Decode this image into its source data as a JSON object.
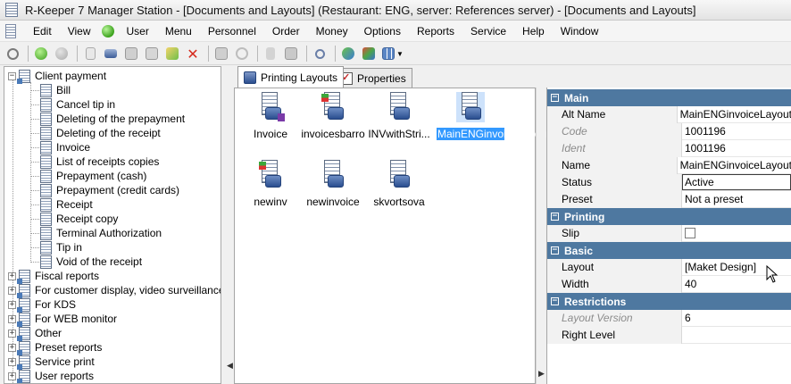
{
  "window": {
    "title": "R-Keeper 7 Manager Station - [Documents and Layouts] (Restaurant: ENG, server: References server) - [Documents and Layouts]"
  },
  "menu": [
    "Edit",
    "View",
    "User",
    "Menu",
    "Personnel",
    "Order",
    "Money",
    "Options",
    "Reports",
    "Service",
    "Help",
    "Window"
  ],
  "toolbar": {
    "icons": [
      "refresh-icon",
      "back-icon",
      "forward-icon",
      "new-document-icon",
      "print-icon",
      "copy-icon",
      "paste-icon",
      "export-icon",
      "delete-icon",
      "save-icon",
      "undo-icon",
      "cut-icon",
      "clipboard-icon",
      "find-icon",
      "sync-icon",
      "layout-icon",
      "grid-view-icon"
    ]
  },
  "tree": {
    "root": "Client payment",
    "children": [
      "Bill",
      "Cancel tip in",
      "Deleting of the prepayment",
      "Deleting of the receipt",
      "Invoice",
      "List of receipts copies",
      "Prepayment (cash)",
      "Prepayment (credit cards)",
      "Receipt",
      "Receipt copy",
      "Terminal Authorization",
      "Tip in",
      "Void of the receipt"
    ],
    "groups": [
      "Fiscal reports",
      "For customer display, video surveillance",
      "For KDS",
      "For WEB monitor",
      "Other",
      "Preset reports",
      "Service print",
      "User reports"
    ]
  },
  "tabs": {
    "printing_layouts": "Printing Layouts",
    "properties": "Properties"
  },
  "layouts": [
    {
      "name": "Invoice",
      "badge": "purple"
    },
    {
      "name": "invoicesbarro",
      "badge": "green-red"
    },
    {
      "name": "INVwithStri...",
      "badge": "none"
    },
    {
      "name": "MainENGinvoiceLayout",
      "badge": "none",
      "selected": true
    },
    {
      "name": "newinv",
      "badge": "green-red"
    },
    {
      "name": "newinvoice",
      "badge": "none"
    },
    {
      "name": "skvortsova",
      "badge": "none"
    }
  ],
  "properties": {
    "main": {
      "title": "Main",
      "alt_name_label": "Alt Name",
      "alt_name": "MainENGinvoiceLayout",
      "code_label": "Code",
      "code": "1001196",
      "ident_label": "Ident",
      "ident": "1001196",
      "name_label": "Name",
      "name": "MainENGinvoiceLayout",
      "status_label": "Status",
      "status": "Active",
      "preset_label": "Preset",
      "preset": "Not a preset"
    },
    "printing": {
      "title": "Printing",
      "slip_label": "Slip",
      "slip_checked": false
    },
    "basic": {
      "title": "Basic",
      "layout_label": "Layout",
      "layout": "[Maket Design]",
      "width_label": "Width",
      "width": "40"
    },
    "restrictions": {
      "title": "Restrictions",
      "layout_version_label": "Layout Version",
      "layout_version": "6",
      "right_level_label": "Right Level",
      "right_level": ""
    }
  }
}
